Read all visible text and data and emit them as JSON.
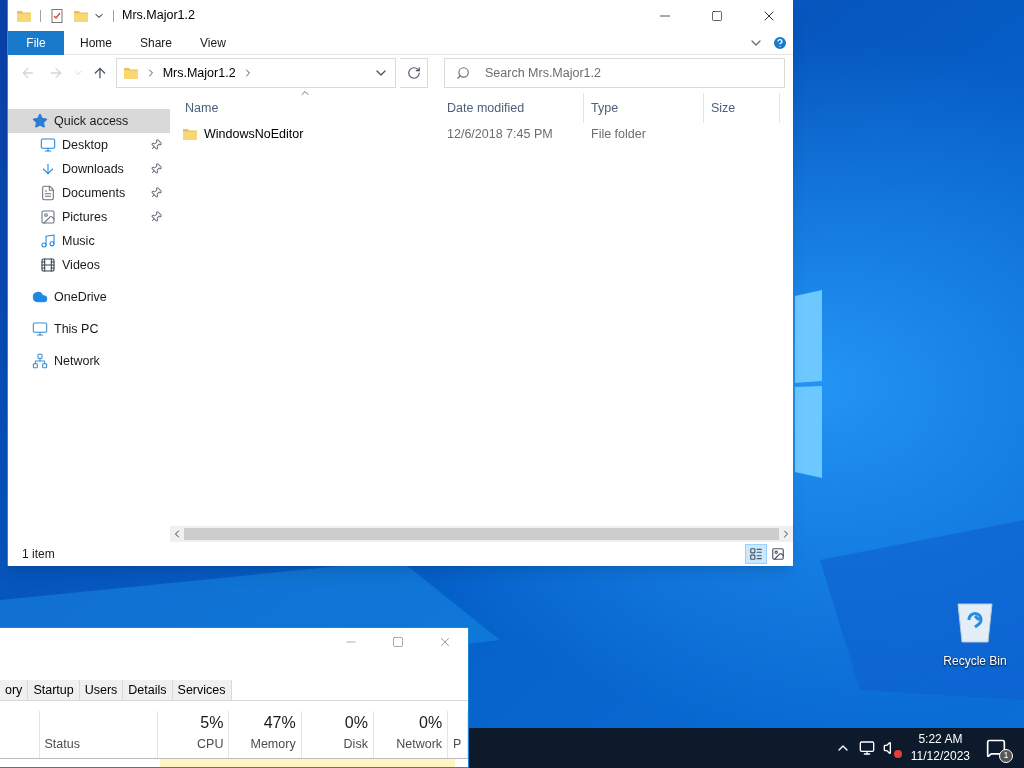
{
  "explorer": {
    "title": "Mrs.Major1.2",
    "ribbon": {
      "file_button": "File",
      "tabs": [
        {
          "label": "Home",
          "selected": false
        },
        {
          "label": "Share",
          "selected": false
        },
        {
          "label": "View",
          "selected": false
        }
      ]
    },
    "address": {
      "path": [
        "Mrs.Major1.2"
      ]
    },
    "search": {
      "placeholder": "Search Mrs.Major1.2"
    },
    "sidebar": {
      "items": [
        {
          "label": "Quick access",
          "kind": "quick",
          "selected": true,
          "children": [
            {
              "label": "Desktop",
              "kind": "desktop",
              "pinned": true
            },
            {
              "label": "Downloads",
              "kind": "downloads",
              "pinned": true
            },
            {
              "label": "Documents",
              "kind": "documents",
              "pinned": true
            },
            {
              "label": "Pictures",
              "kind": "pictures",
              "pinned": true
            },
            {
              "label": "Music",
              "kind": "music",
              "pinned": false
            },
            {
              "label": "Videos",
              "kind": "videos",
              "pinned": false
            }
          ]
        },
        {
          "label": "OneDrive",
          "kind": "cloud",
          "selected": false
        },
        {
          "label": "This PC",
          "kind": "pc",
          "selected": false
        },
        {
          "label": "Network",
          "kind": "network",
          "selected": false
        }
      ]
    },
    "columns": [
      {
        "label": "Name",
        "sorted": true
      },
      {
        "label": "Date modified",
        "sorted": false
      },
      {
        "label": "Type",
        "sorted": false
      },
      {
        "label": "Size",
        "sorted": false
      }
    ],
    "rows": [
      {
        "name": "WindowsNoEditor",
        "date": "12/6/2018 7:45 PM",
        "type": "File folder"
      }
    ],
    "status": "1 item",
    "views": [
      {
        "kind": "details",
        "selected": true
      },
      {
        "kind": "large",
        "selected": false
      }
    ]
  },
  "task_manager": {
    "tabs": [
      {
        "label": "ory",
        "selected": false
      },
      {
        "label": "Startup",
        "selected": false
      },
      {
        "label": "Users",
        "selected": false
      },
      {
        "label": "Details",
        "selected": false
      },
      {
        "label": "Services",
        "selected": false
      }
    ],
    "columns": [
      {
        "label": "Status"
      },
      {
        "usage": "5%",
        "label": "CPU"
      },
      {
        "usage": "47%",
        "label": "Memory"
      },
      {
        "usage": "0%",
        "label": "Disk"
      },
      {
        "usage": "0%",
        "label": "Network"
      },
      {
        "label": "P"
      }
    ]
  },
  "desktop": {
    "icons": [
      {
        "label": "Recycle Bin"
      }
    ]
  },
  "taskbar": {
    "time": "5:22 AM",
    "date": "11/12/2023",
    "notifications": "1"
  }
}
